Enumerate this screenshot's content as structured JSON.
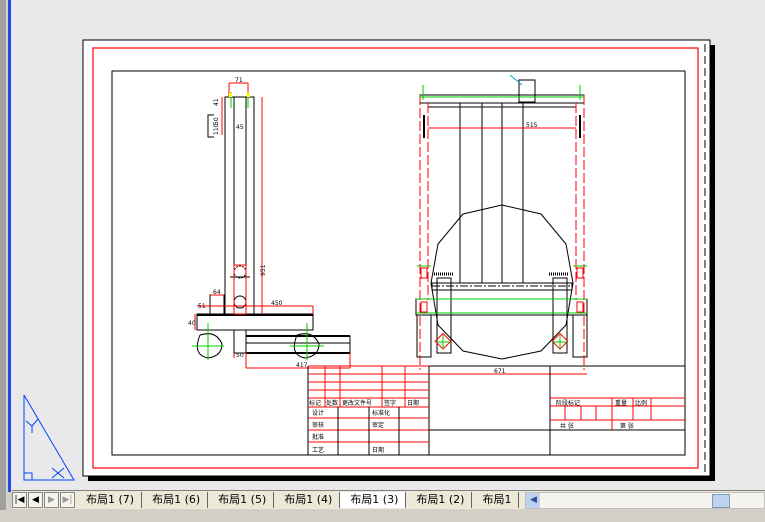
{
  "layout_tabs": [
    "布局1 (7)",
    "布局1 (6)",
    "布局1 (5)",
    "布局1 (4)",
    "布局1 (3)",
    "布局1 (2)",
    "布局1"
  ],
  "active_tab": "布局1 (3)",
  "nav_icons": [
    "first-tab-icon",
    "prev-tab-icon",
    "next-tab-icon",
    "last-tab-icon"
  ],
  "colors": {
    "canvas": "#e9e9ec",
    "paper": "#ffffff",
    "border_red": "#ff0000",
    "centerline_green": "#00cc00",
    "ucs_blue": "#0044ff"
  },
  "ucs": {
    "y_label": "Y",
    "x_label": "X"
  },
  "dimensions": {
    "side_top_width": "71",
    "side_d1": "41",
    "side_d2": "50",
    "side_d3": "110",
    "side_inner": "45",
    "side_height": "951",
    "side_block": "64",
    "side_left": "51",
    "side_base": "40",
    "side_length": "450",
    "side_bottom": "50",
    "side_long": "417",
    "front_inner": "515",
    "front_total": "671"
  },
  "title_block": {
    "rev_headers": [
      "标记",
      "处数",
      "更改文件号",
      "签字",
      "日期"
    ],
    "rows": [
      {
        "left": "设计",
        "right": "标准化"
      },
      {
        "left": "审核",
        "right": "审定"
      },
      {
        "left": "批准",
        "right": ""
      },
      {
        "left": "工艺",
        "right": "日期"
      }
    ],
    "stage_headers": [
      "阶段标记",
      "重量",
      "比例"
    ],
    "sheet_total": "共  张",
    "sheet_num": "第  张"
  }
}
